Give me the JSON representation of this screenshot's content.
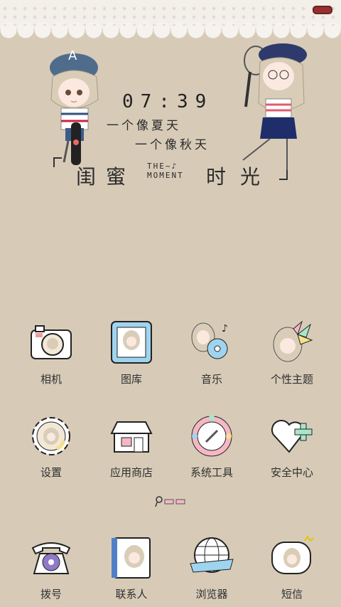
{
  "status_bar": {
    "battery_icon": "battery-icon"
  },
  "widget": {
    "time": "07:39",
    "line1": "一个像夏天",
    "line2": "一个像秋天",
    "title_left": "闺蜜",
    "title_mid_top": "THE~♪",
    "title_mid_bottom": "MOMENT",
    "title_right": "时光"
  },
  "apps_row1": [
    {
      "label": "相机",
      "icon": "camera-icon"
    },
    {
      "label": "图库",
      "icon": "gallery-icon"
    },
    {
      "label": "音乐",
      "icon": "music-icon"
    },
    {
      "label": "个性主题",
      "icon": "theme-icon"
    }
  ],
  "apps_row2": [
    {
      "label": "设置",
      "icon": "gear-icon"
    },
    {
      "label": "应用商店",
      "icon": "store-icon"
    },
    {
      "label": "系统工具",
      "icon": "tools-icon"
    },
    {
      "label": "安全中心",
      "icon": "security-icon"
    }
  ],
  "dock": [
    {
      "label": "拨号",
      "icon": "phone-icon"
    },
    {
      "label": "联系人",
      "icon": "contacts-icon"
    },
    {
      "label": "浏览器",
      "icon": "browser-icon"
    },
    {
      "label": "短信",
      "icon": "message-icon"
    }
  ],
  "colors": {
    "background": "#d7cbb8",
    "accent_blue": "#9fd4ef",
    "accent_pink": "#f5b7c4",
    "accent_green": "#a8e6c9"
  }
}
